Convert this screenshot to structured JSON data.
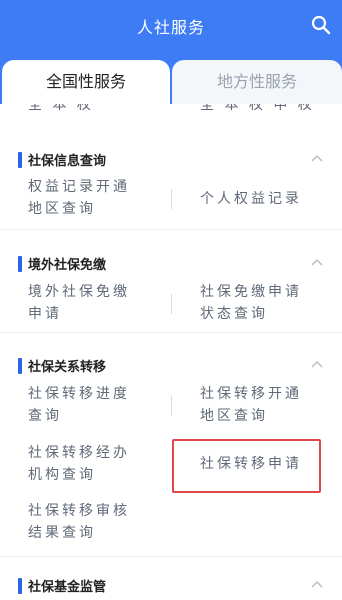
{
  "header": {
    "title": "人社服务",
    "search_icon": "search-icon"
  },
  "tabs": [
    {
      "label": "全国性服务",
      "active": true
    },
    {
      "label": "地方性服务",
      "active": false
    }
  ],
  "cutoff": {
    "left": "全 本 权",
    "right": "全 本 权 申 权"
  },
  "sections": [
    {
      "title": "社保信息查询",
      "items": [
        [
          "权益记录开通",
          "地区查询"
        ],
        [
          "个人权益记录"
        ]
      ]
    },
    {
      "title": "境外社保免缴",
      "items": [
        [
          "境外社保免缴",
          "申请"
        ],
        [
          "社保免缴申请",
          "状态查询"
        ]
      ]
    },
    {
      "title": "社保关系转移",
      "items": [
        [
          "社保转移进度",
          "查询"
        ],
        [
          "社保转移开通",
          "地区查询"
        ],
        [
          "社保转移经办",
          "机构查询"
        ],
        [
          "社保转移申请"
        ],
        [
          "社保转移审核",
          "结果查询"
        ]
      ]
    },
    {
      "title": "社保基金监管",
      "items": []
    }
  ],
  "colors": {
    "accent": "#3d7cf4",
    "highlight": "#e0474c"
  }
}
